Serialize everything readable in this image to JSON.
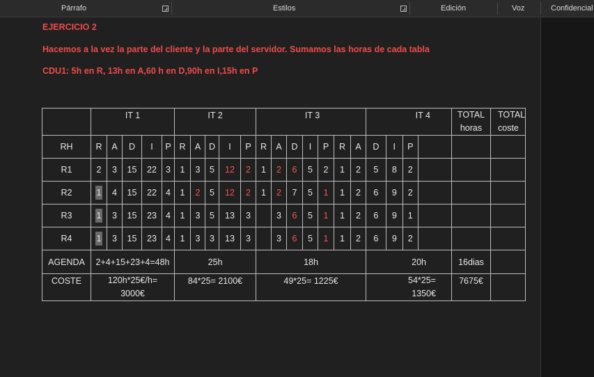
{
  "ribbon": {
    "paragraph": "Párrafo",
    "styles": "Estilos",
    "editing": "Edición",
    "voice": "Voz",
    "confidential": "Confidencial"
  },
  "document": {
    "heading": "EJERCICIO 2",
    "line1": "Hacemos a la vez la parte del cliente y la parte del servidor. Sumamos las horas de cada tabla",
    "line2": "CDU1: 5h en R, 13h en A,60 h en D,90h en I,15h en P"
  },
  "table": {
    "header": {
      "it1": "IT 1",
      "it2": "IT 2",
      "it3": "IT 3",
      "it4": "IT 4",
      "total_horas": "TOTAL horas",
      "total_coste": "TOTAL coste"
    },
    "rh_label": "RH",
    "phases": [
      "R",
      "A",
      "D",
      "I",
      "P",
      "R",
      "A",
      "D",
      "I",
      "P",
      "R",
      "A",
      "D",
      "I",
      "P",
      "R",
      "A",
      "D",
      "I",
      "P"
    ],
    "rows": [
      {
        "label": "R1",
        "cells": [
          "2",
          "3",
          "15",
          "22",
          "3",
          "1",
          "3",
          "5",
          "12",
          "2",
          "1",
          "2",
          "6",
          "5",
          "2",
          "1",
          "2",
          "5",
          "8",
          "2"
        ]
      },
      {
        "label": "R2",
        "cells": [
          "1",
          "4",
          "15",
          "22",
          "4",
          "1",
          "2",
          "5",
          "12",
          "2",
          "1",
          "2",
          "7",
          "5",
          "1",
          "1",
          "2",
          "6",
          "9",
          "2"
        ]
      },
      {
        "label": "R3",
        "cells": [
          "1",
          "3",
          "15",
          "23",
          "4",
          "1",
          "3",
          "5",
          "13",
          "3",
          "",
          "3",
          "6",
          "5",
          "1",
          "1",
          "2",
          "6",
          "9",
          "1"
        ]
      },
      {
        "label": "R4",
        "cells": [
          "1",
          "3",
          "15",
          "23",
          "4",
          "1",
          "3",
          "3",
          "13",
          "3",
          "",
          "3",
          "6",
          "5",
          "1",
          "1",
          "2",
          "6",
          "9",
          "2"
        ]
      }
    ],
    "agenda": {
      "label": "AGENDA",
      "it1": "2+4+15+23+4=48h",
      "it2": "25h",
      "it3": "18h",
      "it4": "20h",
      "total": "16dias"
    },
    "coste": {
      "label": "COSTE",
      "it1": "120h*25€/h= 3000€",
      "it2": "84*25= 2100€",
      "it3": "49*25= 1225€",
      "it4": "54*25= 1350€",
      "total": "7675€"
    },
    "colors": {
      "red": "#ef5656",
      "text": "#e6e6e6",
      "border": "#bdbdbd"
    }
  }
}
